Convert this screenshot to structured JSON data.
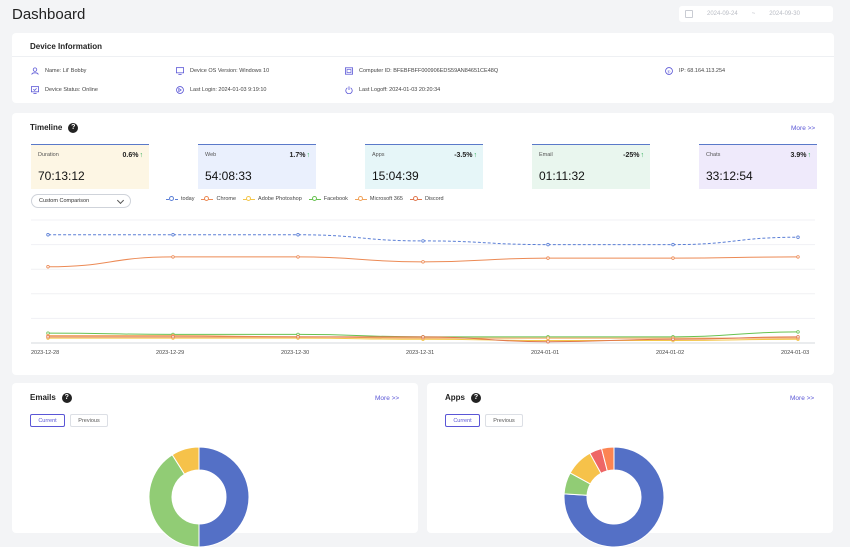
{
  "header": {
    "title": "Dashboard",
    "date_from": "2024-09-24",
    "date_sep": "~",
    "date_to": "2024-09-30"
  },
  "device": {
    "title": "Device Information",
    "name": "Name: Lil' Bobby",
    "status": "Device Status: Online",
    "os": "Device OS Version: Windows 10",
    "last_login": "Last Login: 2024-01-03 9:19:10",
    "computer_id": "Computer ID: BFEBFBFF000906EDS59AN84651CE48Q",
    "last_logoff": "Last Logoff: 2024-01-03 20:20:34",
    "ip": "IP: 68.164.113.254"
  },
  "timeline": {
    "title": "Timeline",
    "help": "?",
    "more": "More >>",
    "stats": [
      {
        "label": "Duration",
        "pct": "0.6%",
        "value": "70:13:12",
        "bg": "#fdf6e4"
      },
      {
        "label": "Web",
        "pct": "1.7%",
        "value": "54:08:33",
        "bg": "#eaf0fd"
      },
      {
        "label": "Apps",
        "pct": "-3.5%",
        "value": "15:04:39",
        "bg": "#e6f6f8"
      },
      {
        "label": "Email",
        "pct": "-25%",
        "value": "01:11:32",
        "bg": "#e9f6ee"
      },
      {
        "label": "Chats",
        "pct": "3.9%",
        "value": "33:12:54",
        "bg": "#efeafb"
      }
    ],
    "arrow": "↑",
    "select_value": "Custom Comparison",
    "legend": [
      {
        "name": "today",
        "color": "#5b7fd6",
        "dashed": true
      },
      {
        "name": "Chrome",
        "color": "#ec8a55"
      },
      {
        "name": "Adobe Photoshop",
        "color": "#f3c64b"
      },
      {
        "name": "Facebook",
        "color": "#68c250"
      },
      {
        "name": "Microsoft 365",
        "color": "#f0a25a"
      },
      {
        "name": "Discord",
        "color": "#e0784f"
      }
    ]
  },
  "chart_data": {
    "type": "line",
    "x": [
      "2023-12-28",
      "2023-12-29",
      "2023-12-30",
      "2023-12-31",
      "2024-01-01",
      "2024-01-02",
      "2024-01-03"
    ],
    "ylim": [
      0,
      100
    ],
    "grid": true,
    "series": [
      {
        "name": "today",
        "color": "#5b7fd6",
        "dashed": true,
        "values": [
          88,
          88,
          88,
          83,
          80,
          80,
          86
        ]
      },
      {
        "name": "Chrome",
        "color": "#ec8a55",
        "values": [
          62,
          70,
          70,
          66,
          69,
          69,
          70
        ]
      },
      {
        "name": "Adobe Photoshop",
        "color": "#f3c64b",
        "values": [
          4,
          4,
          4,
          3,
          2,
          2,
          3
        ]
      },
      {
        "name": "Facebook",
        "color": "#68c250",
        "values": [
          8,
          7,
          7,
          5,
          5,
          5,
          9
        ]
      },
      {
        "name": "Microsoft 365",
        "color": "#f0a25a",
        "values": [
          6,
          6,
          5,
          4,
          4,
          4,
          4
        ]
      },
      {
        "name": "Discord",
        "color": "#e0784f",
        "values": [
          5,
          5,
          5,
          5,
          1,
          3,
          5
        ]
      }
    ]
  },
  "emails": {
    "title": "Emails",
    "help": "?",
    "more": "More >>",
    "tab_current": "Current",
    "tab_previous": "Previous",
    "donut": [
      {
        "label": "blue",
        "value": 50,
        "color": "#5470c6"
      },
      {
        "label": "green",
        "value": 41,
        "color": "#91cc75"
      },
      {
        "label": "yellow",
        "value": 9,
        "color": "#f6c24a"
      }
    ]
  },
  "apps": {
    "title": "Apps",
    "help": "?",
    "more": "More >>",
    "tab_current": "Current",
    "tab_previous": "Previous",
    "donut": [
      {
        "label": "blue",
        "value": 76,
        "color": "#5470c6"
      },
      {
        "label": "green",
        "value": 7,
        "color": "#91cc75"
      },
      {
        "label": "yellow",
        "value": 9,
        "color": "#f6c24a"
      },
      {
        "label": "red",
        "value": 4,
        "color": "#ee6666"
      },
      {
        "label": "orange",
        "value": 4,
        "color": "#fc8452"
      }
    ]
  }
}
